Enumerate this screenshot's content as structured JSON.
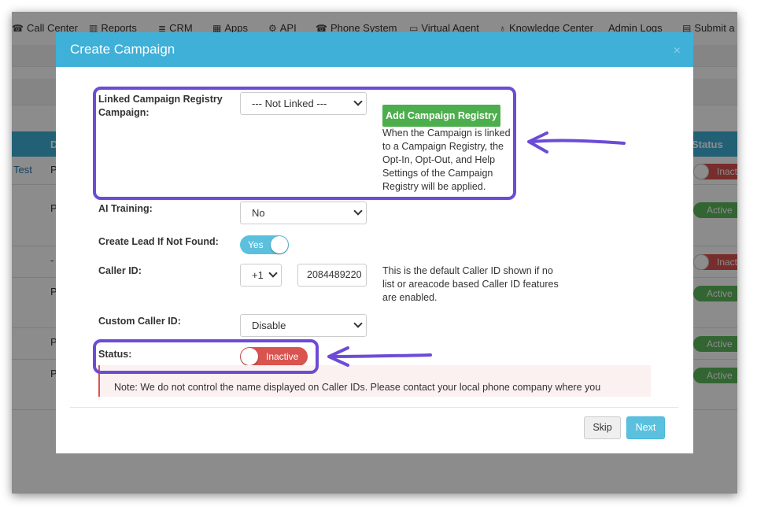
{
  "nav": {
    "items": [
      {
        "label": "Call Center",
        "icon": "phone-icon",
        "glyph": "☎"
      },
      {
        "label": "Reports",
        "icon": "bar-chart-icon",
        "glyph": "▥"
      },
      {
        "label": "CRM",
        "icon": "list-icon",
        "glyph": "≣"
      },
      {
        "label": "Apps",
        "icon": "grid-icon",
        "glyph": "▦"
      },
      {
        "label": "API",
        "icon": "gear-icon",
        "glyph": "⚙"
      },
      {
        "label": "Phone System",
        "icon": "phone-icon",
        "glyph": "☎"
      },
      {
        "label": "Virtual Agent",
        "icon": "monitor-icon",
        "glyph": "▭"
      },
      {
        "label": "Knowledge Center",
        "icon": "lightbulb-icon",
        "glyph": "♁"
      },
      {
        "label": "Admin Logs",
        "icon": "",
        "glyph": ""
      },
      {
        "label": "Submit a r",
        "icon": "ticket-icon",
        "glyph": "▤"
      }
    ]
  },
  "background": {
    "table_header": {
      "col_d": "D",
      "col_status": "Status"
    },
    "rows": [
      {
        "name": "Test",
        "desc": "P",
        "status": "Inact"
      },
      {
        "name": "",
        "desc": "P",
        "status": "Active"
      },
      {
        "name": "",
        "desc": "-",
        "status": "Inact"
      },
      {
        "name": "",
        "desc": "P",
        "status": "Active"
      },
      {
        "name": "",
        "desc": "P",
        "status": "Active"
      },
      {
        "name": "",
        "desc": "P",
        "status": "Active"
      }
    ]
  },
  "modal": {
    "title": "Create Campaign",
    "close_glyph": "×",
    "linked_registry": {
      "label": "Linked Campaign Registry Campaign:",
      "value": "--- Not Linked ---",
      "add_button": "Add Campaign Registry",
      "help": "When the Campaign is linked to a Campaign Registry, the Opt-In, Opt-Out, and Help Settings of the Campaign Registry will be applied."
    },
    "ai_training": {
      "label": "AI Training:",
      "value": "No"
    },
    "create_lead": {
      "label": "Create Lead If Not Found:",
      "toggle_label": "Yes",
      "on": true
    },
    "caller_id": {
      "label": "Caller ID:",
      "country_code": "+1",
      "number": "2084489220",
      "help": "This is the default Caller ID shown if no list or areacode based Caller ID features are enabled."
    },
    "custom_caller_id": {
      "label": "Custom Caller ID:",
      "value": "Disable"
    },
    "status": {
      "label": "Status:",
      "toggle_label": "Inactive",
      "on": false
    },
    "note": "Note: We do not control the name displayed on Caller IDs. Please contact your local phone company where you",
    "skip_label": "Skip",
    "next_label": "Next"
  },
  "colors": {
    "header_blue": "#3fb0d8",
    "success_green": "#4cae4c",
    "danger_red": "#d9534f",
    "annotation_purple": "#6c4cd6"
  }
}
